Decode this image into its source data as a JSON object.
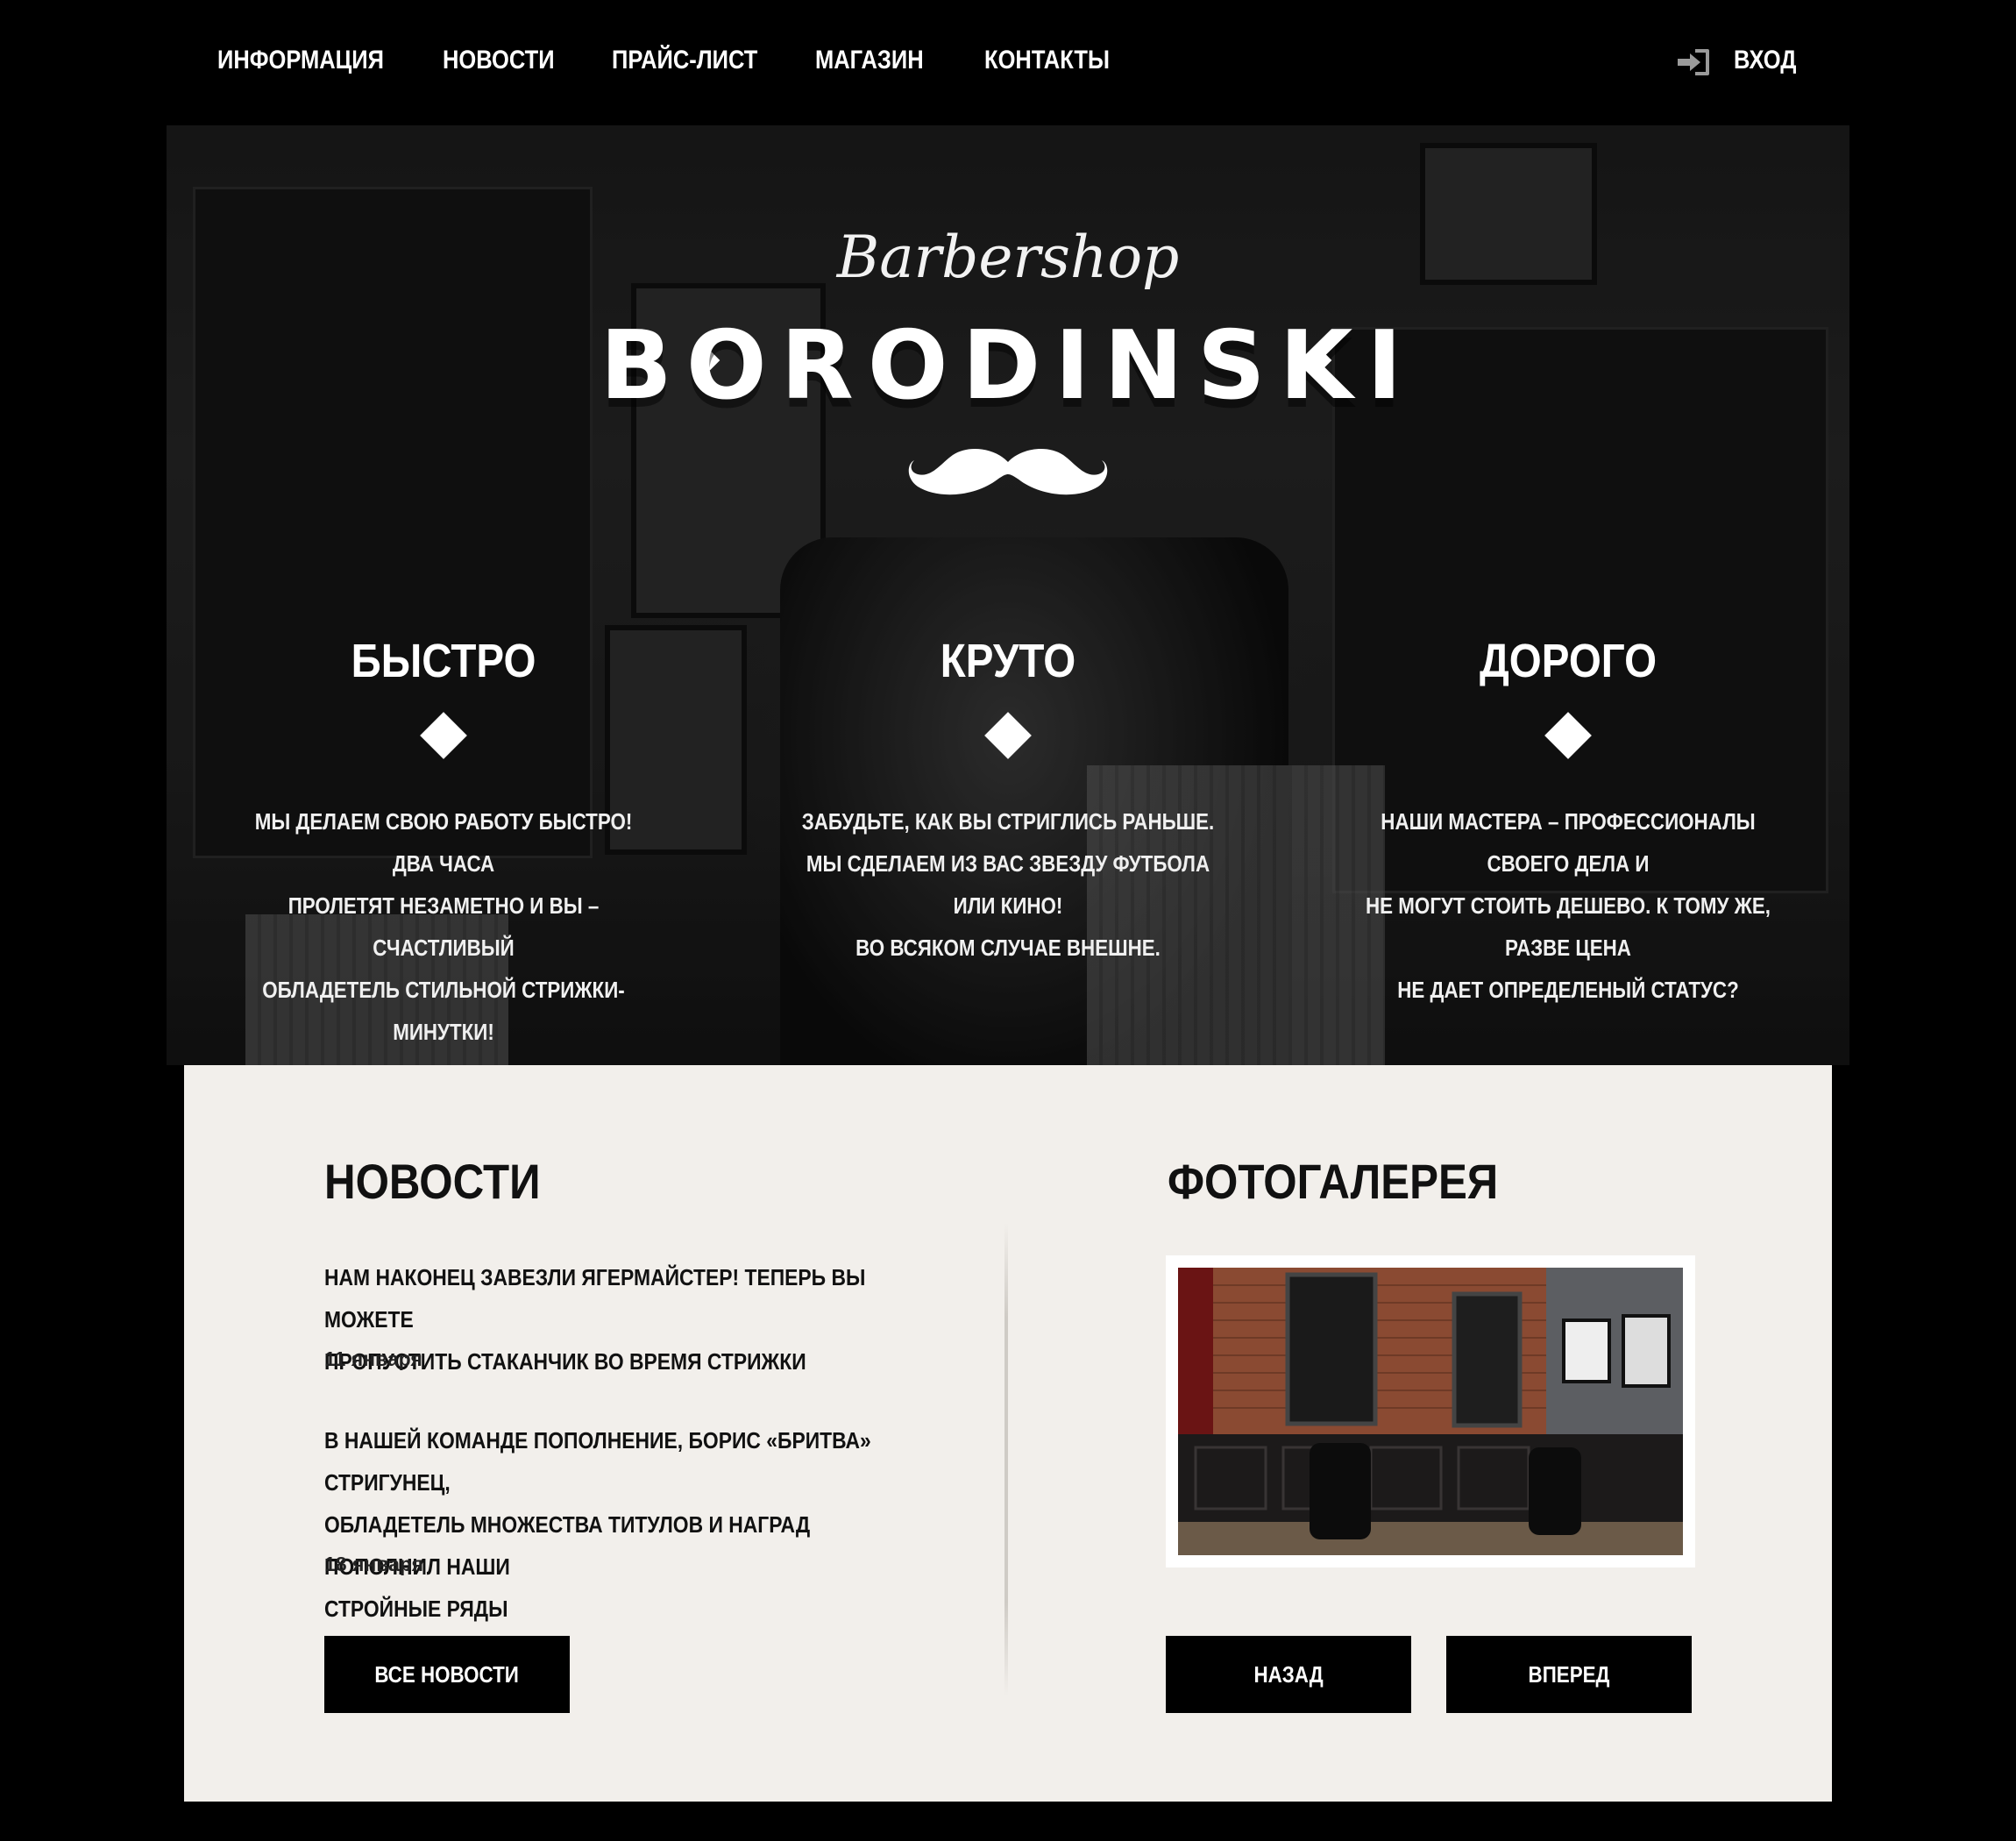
{
  "nav": {
    "items": [
      {
        "label": "ИНФОРМАЦИЯ"
      },
      {
        "label": "НОВОСТИ"
      },
      {
        "label": "ПРАЙС-ЛИСТ"
      },
      {
        "label": "МАГАЗИН"
      },
      {
        "label": "КОНТАКТЫ"
      }
    ],
    "login": {
      "icon": "sign-in-icon",
      "label": "ВХОД"
    }
  },
  "hero": {
    "script_title": "Barbershop",
    "brand": "BORODINSKI",
    "logo_icon": "mustache-icon",
    "features": [
      {
        "title": "БЫСТРО",
        "lines": [
          "МЫ ДЕЛАЕМ СВОЮ РАБОТУ БЫСТРО! ДВА ЧАСА",
          "ПРОЛЕТЯТ НЕЗАМЕТНО И ВЫ – СЧАСТЛИВЫЙ",
          "ОБЛАДЕТЕЛЬ СТИЛЬНОЙ СТРИЖКИ-МИНУТКИ!"
        ]
      },
      {
        "title": "КРУТО",
        "lines": [
          "ЗАБУДЬТЕ, КАК ВЫ СТРИГЛИСЬ РАНЬШЕ.",
          "МЫ СДЕЛАЕМ ИЗ ВАС ЗВЕЗДУ ФУТБОЛА ИЛИ КИНО!",
          "ВО ВСЯКОМ СЛУЧАЕ ВНЕШНЕ."
        ]
      },
      {
        "title": "ДОРОГО",
        "lines": [
          "НАШИ МАСТЕРА – ПРОФЕССИОНАЛЫ СВОЕГО ДЕЛА И",
          "НЕ МОГУТ СТОИТЬ ДЕШЕВО. К ТОМУ ЖЕ, РАЗВЕ ЦЕНА",
          "НЕ ДАЕТ ОПРЕДЕЛЕНЫЙ СТАТУС?"
        ]
      }
    ]
  },
  "news": {
    "title": "НОВОСТИ",
    "items": [
      {
        "lines": [
          "НАМ НАКОНЕЦ ЗАВЕЗЛИ ЯГЕРМАЙСТЕР! ТЕПЕРЬ ВЫ МОЖЕТЕ",
          "ПРОПУСТИТЬ СТАКАНЧИК ВО ВРЕМЯ СТРИЖКИ"
        ],
        "date": "11 января"
      },
      {
        "lines": [
          "В НАШЕЙ КОМАНДЕ ПОПОЛНЕНИЕ, БОРИС «БРИТВА» СТРИГУНЕЦ,",
          "ОБЛАДЕТЕЛЬ МНОЖЕСТВА ТИТУЛОВ И НАГРАД ПОПОЛНИЛ НАШИ",
          "СТРОЙНЫЕ РЯДЫ"
        ],
        "date": "18 января"
      }
    ],
    "all_button": "ВСЕ НОВОСТИ"
  },
  "gallery": {
    "title": "ФОТОГАЛЕРЕЯ",
    "prev_button": "НАЗАД",
    "next_button": "ВПЕРЕД"
  },
  "colors": {
    "background": "#000000",
    "panel": "#f2efeb",
    "accent_brick": "#8a4a32"
  }
}
